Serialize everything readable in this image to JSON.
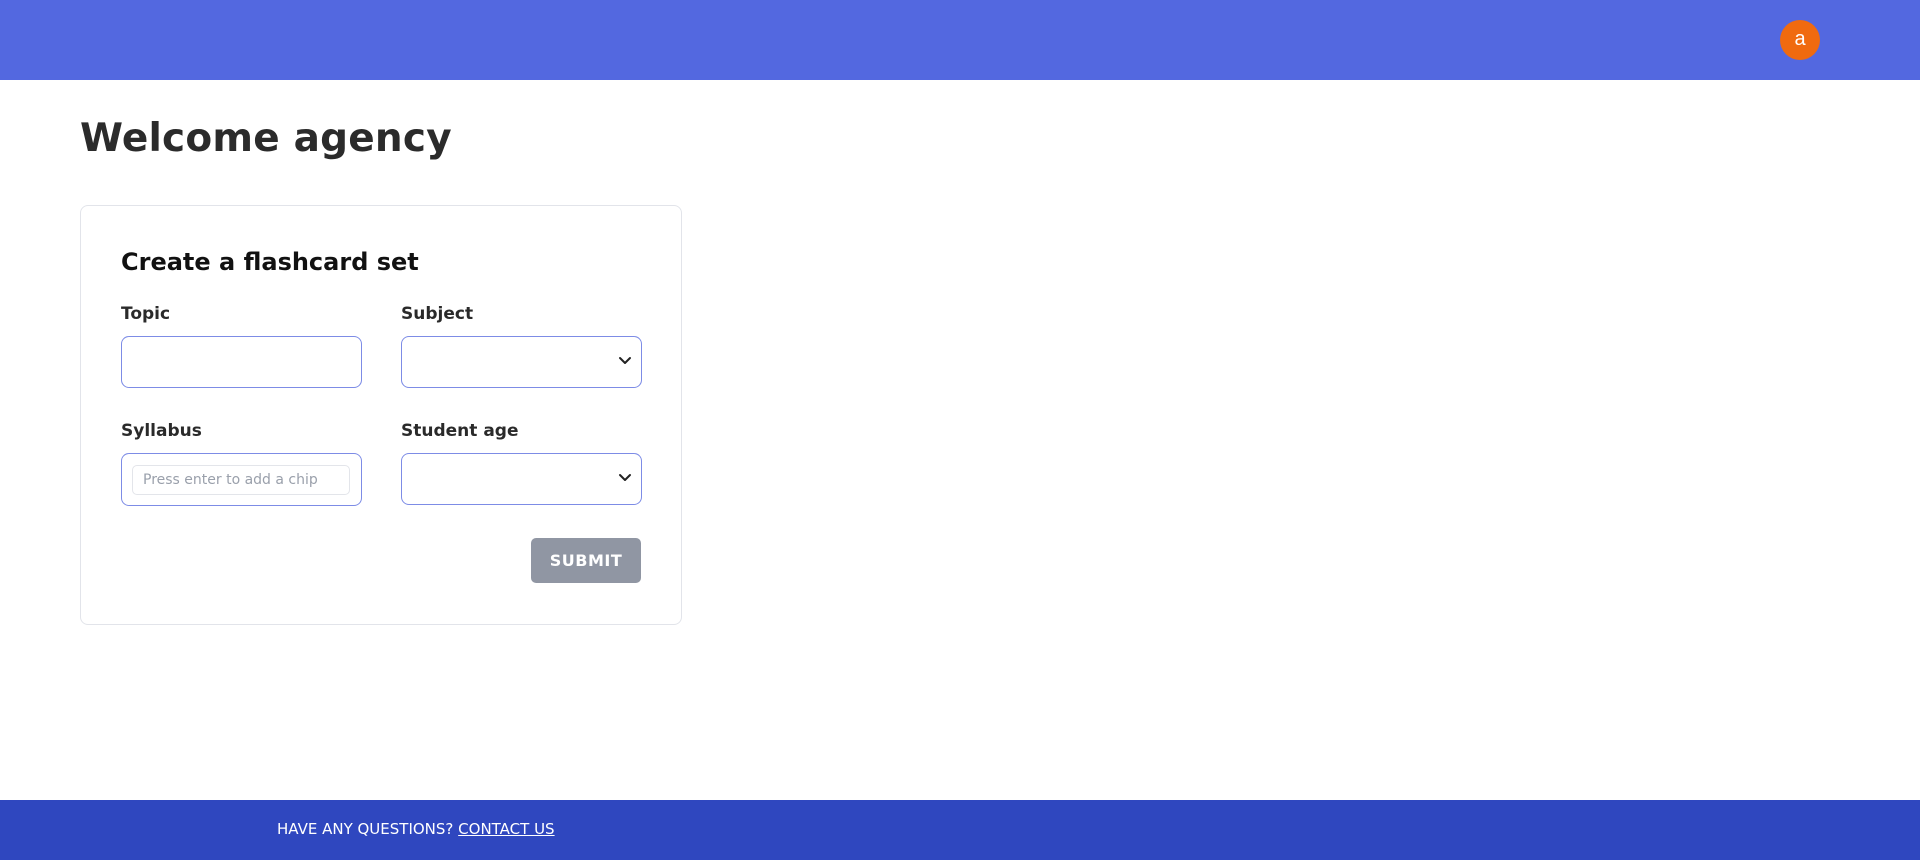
{
  "header": {
    "avatar_letter": "a"
  },
  "main": {
    "title": "Welcome agency"
  },
  "form": {
    "title": "Create a flashcard set",
    "topic": {
      "label": "Topic",
      "value": ""
    },
    "subject": {
      "label": "Subject",
      "value": ""
    },
    "syllabus": {
      "label": "Syllabus",
      "placeholder": "Press enter to add a chip"
    },
    "student_age": {
      "label": "Student age",
      "value": ""
    },
    "submit_label": "SUBMIT"
  },
  "footer": {
    "question_text": "HAVE ANY QUESTIONS?",
    "contact_link": "CONTACT US"
  },
  "colors": {
    "header_bg": "#5368e0",
    "avatar_bg": "#f06a0f",
    "footer_bg": "#2f47bf",
    "input_border": "#7d8ce6",
    "submit_bg": "#9096a3"
  }
}
